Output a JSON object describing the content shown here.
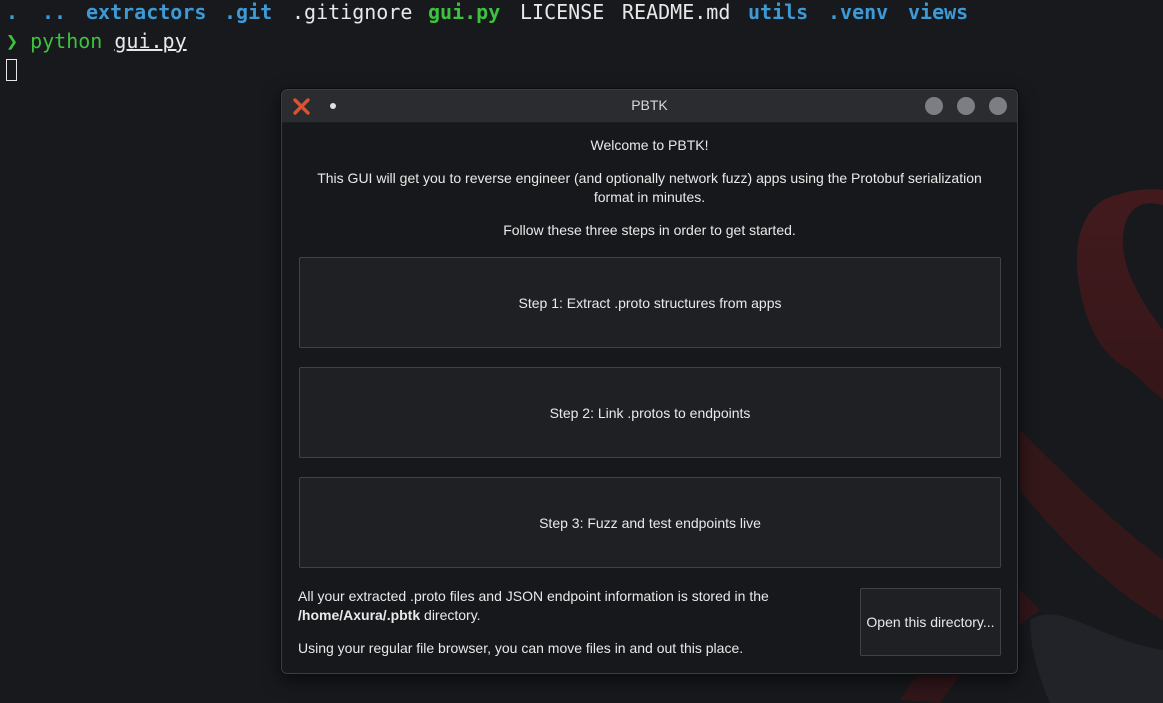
{
  "terminal": {
    "ls_items": [
      {
        "name": ".",
        "kind": "dir"
      },
      {
        "name": "..",
        "kind": "dir"
      },
      {
        "name": "extractors",
        "kind": "dir"
      },
      {
        "name": ".git",
        "kind": "dir"
      },
      {
        "name": ".gitignore",
        "kind": "file"
      },
      {
        "name": "gui.py",
        "kind": "exec"
      },
      {
        "name": "LICENSE",
        "kind": "file"
      },
      {
        "name": "README.md",
        "kind": "file"
      },
      {
        "name": "utils",
        "kind": "dir"
      },
      {
        "name": ".venv",
        "kind": "dir"
      },
      {
        "name": "views",
        "kind": "dir"
      }
    ],
    "prompt_symbol": "❯",
    "command": "python",
    "argument": "gui.py",
    "colors": {
      "directory": "#3d9ad6",
      "executable": "#3dc23d",
      "file": "#e8e8e8"
    }
  },
  "window": {
    "title": "PBTK",
    "titlebar_buttons": [
      "close-icon",
      "pin-icon",
      "minimize-button",
      "maximize-button",
      "window-close-button"
    ],
    "welcome": "Welcome to PBTK!",
    "intro": "This GUI will get you to reverse engineer (and optionally network fuzz) apps using the Protobuf serialization format in minutes.",
    "follow": "Follow these three steps in order to get started.",
    "steps": [
      {
        "label": "Step 1: Extract .proto structures from apps"
      },
      {
        "label": "Step 2: Link .protos to endpoints"
      },
      {
        "label": "Step 3: Fuzz and test endpoints live"
      }
    ],
    "info_prefix": "All your extracted .proto files and JSON endpoint information is stored in the",
    "info_path": "/home/Axura/.pbtk",
    "info_suffix": "directory.",
    "info_browser": "Using your regular file browser, you can move files in and out this place.",
    "open_dir_label": "Open this directory..."
  }
}
